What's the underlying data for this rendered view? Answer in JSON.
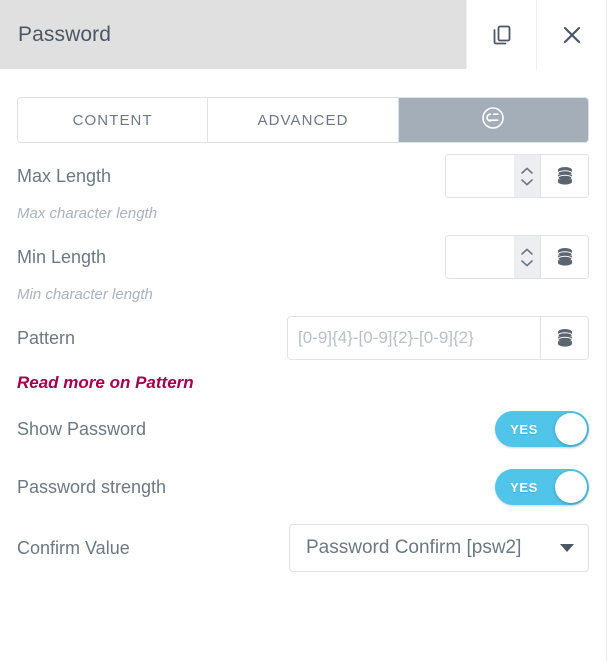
{
  "header": {
    "title": "Password",
    "duplicate_icon": "copy-icon",
    "close_icon": "close-icon"
  },
  "tabs": [
    {
      "label": "CONTENT",
      "active": false
    },
    {
      "label": "ADVANCED",
      "active": false
    },
    {
      "label": "",
      "icon": "elementor-logo-icon",
      "active": true
    }
  ],
  "fields": {
    "max_length": {
      "label": "Max Length",
      "value": "",
      "placeholder": "",
      "hint": "Max character length",
      "dynamic_icon": "database-icon",
      "spinner_icon": "spinner-up-down-icon"
    },
    "min_length": {
      "label": "Min Length",
      "value": "",
      "placeholder": "",
      "hint": "Min character length",
      "dynamic_icon": "database-icon",
      "spinner_icon": "spinner-up-down-icon"
    },
    "pattern": {
      "label": "Pattern",
      "value": "",
      "placeholder": "[0-9]{4}-[0-9]{2}-[0-9]{2}",
      "dynamic_icon": "database-icon",
      "link_text": "Read more on Pattern",
      "link_color": "#a3004c"
    },
    "show_password": {
      "label": "Show Password",
      "toggle_state": "YES",
      "toggle_on": true
    },
    "password_strength": {
      "label": "Password strength",
      "toggle_state": "YES",
      "toggle_on": true
    },
    "confirm_value": {
      "label": "Confirm Value",
      "selected": "Password Confirm [psw2]",
      "caret_icon": "chevron-down-icon"
    }
  },
  "colors": {
    "header_bg": "#e0e0e0",
    "tab_active_bg": "#a4aeb8",
    "toggle_on": "#51c4ea",
    "text": "#6d7882",
    "link": "#a3004c"
  }
}
